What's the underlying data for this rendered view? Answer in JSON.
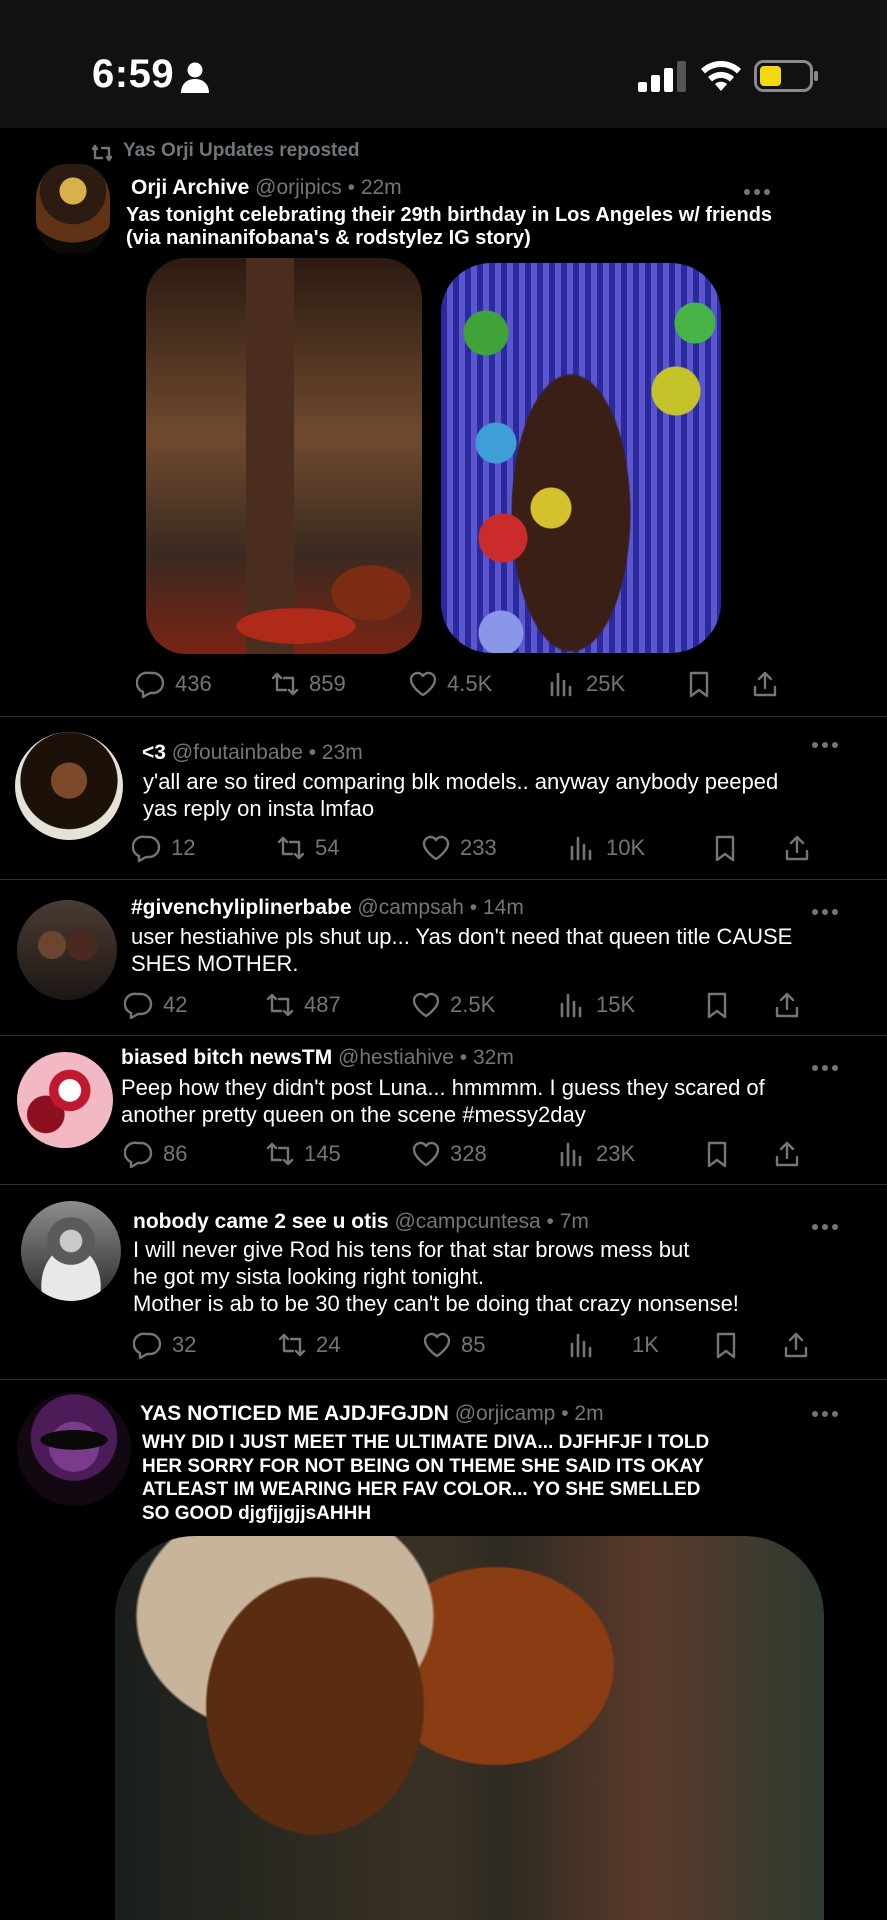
{
  "status_bar": {
    "time": "6:59"
  },
  "repost_banner": "Yas Orji Updates reposted",
  "posts": [
    {
      "name": "Orji Archive",
      "handle": "@orjipics",
      "time": "• 22m",
      "text": "Yas tonight celebrating their 29th birthday in Los Angeles w/ friends\n(via naninanifobana's & rodstylez IG story)",
      "stats": {
        "replies": "436",
        "reposts": "859",
        "likes": "4.5K",
        "views": "25K"
      }
    },
    {
      "name": "<3",
      "handle": "@foutainbabe",
      "time": "• 23m",
      "text": "y'all are so tired comparing blk models.. anyway anybody peeped\nyas reply on insta lmfao",
      "stats": {
        "replies": "12",
        "reposts": "54",
        "likes": "233",
        "views": "10K"
      }
    },
    {
      "name": "#givenchyliplinerbabe",
      "handle": "@campsah",
      "time": "• 14m",
      "text": "user hestiahive pls shut up... Yas don't need that queen title CAUSE\nSHES MOTHER.",
      "stats": {
        "replies": "42",
        "reposts": "487",
        "likes": "2.5K",
        "views": "15K"
      }
    },
    {
      "name": "biased bitch newsTM",
      "handle": "@hestiahive",
      "time": "• 32m",
      "text": "Peep how they didn't post Luna... hmmmm. I guess they scared of\nanother pretty queen  on the scene #messy2day",
      "stats": {
        "replies": "86",
        "reposts": "145",
        "likes": "328",
        "views": "23K"
      }
    },
    {
      "name": "nobody came 2 see u otis",
      "handle": "@campcuntesa",
      "time": "• 7m",
      "text": "I will never give Rod his tens for that star brows mess but\nhe got my sista looking right tonight.\nMother is ab to be 30 they can't be doing that  crazy nonsense!",
      "stats": {
        "replies": "32",
        "reposts": "24",
        "likes": "85",
        "views": "1K"
      }
    },
    {
      "name": "YAS NOTICED ME AJDJFGJDN",
      "handle": "@orjicamp",
      "time": "• 2m",
      "text": "WHY DID I JUST MEET THE ULTIMATE DIVA... DJFHFJF I TOLD\nHER SORRY FOR NOT BEING ON THEME SHE SAID ITS OKAY\nATLEAST IM WEARING HER FAV COLOR... YO SHE SMELLED\nSO GOOD djgfjjgjjsAHHH"
    }
  ],
  "colors": {
    "background": "#000000",
    "muted": "#71767b",
    "divider": "#2f3336",
    "battery": "#f5d90a"
  }
}
